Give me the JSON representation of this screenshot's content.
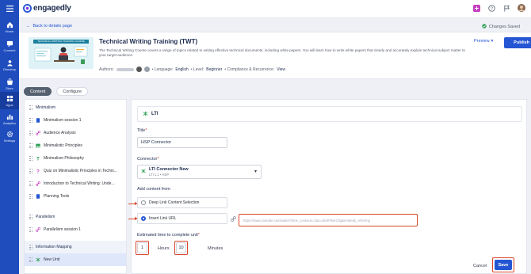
{
  "nav": {
    "items": [
      {
        "label": "Home",
        "icon": "home-icon"
      },
      {
        "label": "Connect",
        "icon": "connect-icon"
      },
      {
        "label": "Directory",
        "icon": "directory-icon"
      },
      {
        "label": "Store",
        "icon": "store-icon"
      },
      {
        "label": "Apps",
        "icon": "apps-icon"
      },
      {
        "label": "Analytics",
        "icon": "analytics-icon"
      },
      {
        "label": "Settings",
        "icon": "settings-icon"
      }
    ],
    "active": "Apps"
  },
  "topbar": {
    "logo_text": "engagedly"
  },
  "header": {
    "back_label": "Back to details page",
    "saved_label": "Changes Saved"
  },
  "course": {
    "thumbnail_banner": "TECHNICAL WRITING TRAINING COURSE",
    "title": "Technical Writing Training (TWT)",
    "description": "The Technical Writing Course covers a range of topics related to writing effective technical documents, including white papers. You will learn how to write white papers that clearly and accurately explain technical subject matter to your target audience.",
    "authors_label": "Authors:",
    "language_label": "• Language:",
    "language_value": "English",
    "level_label": "• Level:",
    "level_value": "Beginner",
    "compliance_label": "• Compliance & Recurrence:",
    "compliance_value": "View",
    "preview_label": "Preview",
    "publish_label": "Publish"
  },
  "tabs": [
    {
      "label": "Content"
    },
    {
      "label": "Configure"
    }
  ],
  "outline": [
    {
      "kind": "section",
      "label": "Minimalism"
    },
    {
      "kind": "item",
      "label": "Minimalism session 1",
      "icon": "document-icon"
    },
    {
      "kind": "item",
      "label": "Audience Analysis",
      "icon": "link-icon"
    },
    {
      "kind": "item",
      "label": "Minimalistic Principles",
      "icon": "image-icon"
    },
    {
      "kind": "item",
      "label": "Minimalism Philosophy",
      "icon": "text-icon"
    },
    {
      "kind": "item",
      "label": "Quiz on Minimalistic Principles in Techni...",
      "icon": "quiz-icon"
    },
    {
      "kind": "item",
      "label": "Introduction to Technical Writing: Unde...",
      "icon": "link-icon"
    },
    {
      "kind": "item",
      "label": "Planning Tools",
      "icon": "document-icon"
    },
    {
      "kind": "section",
      "label": "Parallelism"
    },
    {
      "kind": "item",
      "label": "Parallelism session 1",
      "icon": "link-icon"
    },
    {
      "kind": "section",
      "label": "Information Mapping"
    },
    {
      "kind": "item",
      "label": "New Unit",
      "icon": "lti-icon"
    }
  ],
  "panel": {
    "heading": "LTI",
    "title_label": "Title",
    "title_value": "HSP Connector",
    "connector_label": "Connector",
    "connector_name": "LTI Connector New",
    "connector_sub": "LTI 1.1 • HSP",
    "add_content_label": "Add content from",
    "option_deep_link": "Deep Link Content Selection",
    "option_insert_url": "Insert Link URL",
    "url_value": "https://www.youtube.com/watch?time_continue=2&v=xkr5F9oeC0g&embeds_referring",
    "estimate_label": "Estimated time to complete unit",
    "hours_value": "1",
    "hours_label": "Hours",
    "minutes_value": "10",
    "minutes_label": "Minutes",
    "cancel_label": "Cancel",
    "save_label": "Save"
  },
  "colors": {
    "brand_blue": "#2455d3",
    "nav_blue": "#1f4dbd",
    "highlight_red": "#d9452a"
  }
}
